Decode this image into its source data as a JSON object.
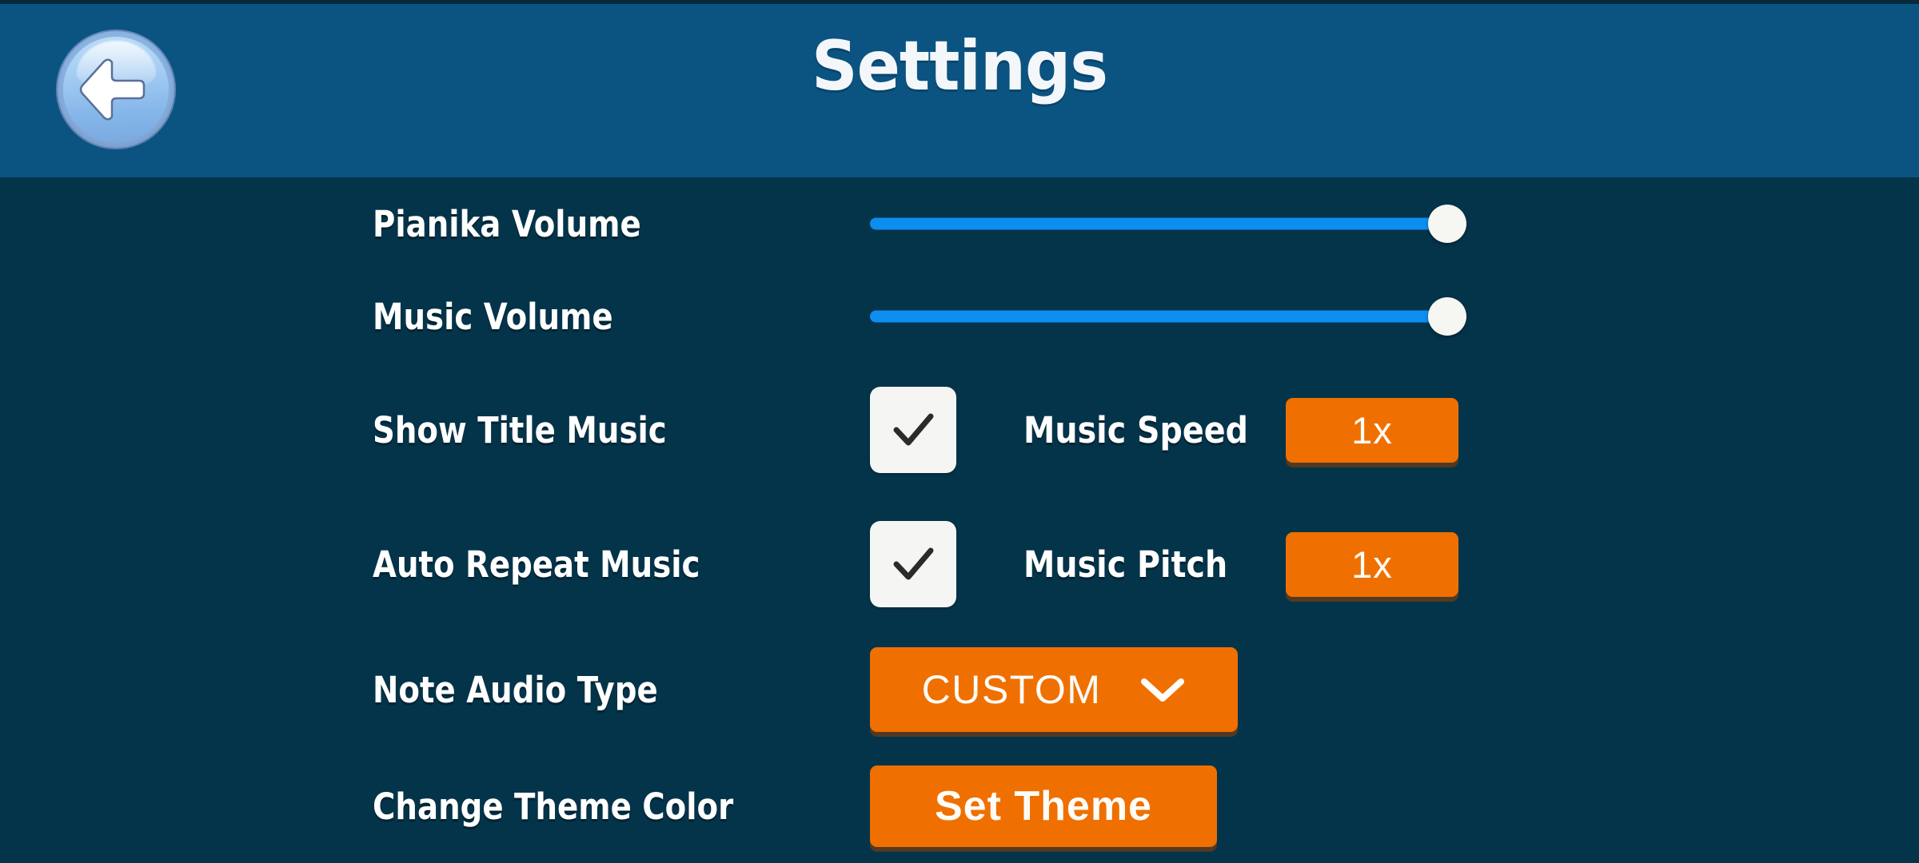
{
  "header": {
    "title": "Settings",
    "back_icon": "back-arrow-icon",
    "background_color": "#0b5482"
  },
  "theme": {
    "page_background": "#04344a",
    "accent_orange": "#ef7000",
    "slider_blue": "#0d8df0",
    "text_white": "#ffffff"
  },
  "rows": [
    {
      "id": "pianika-volume",
      "label": "Pianika Volume",
      "control": "slider",
      "value_percent": 100
    },
    {
      "id": "music-volume",
      "label": "Music Volume",
      "control": "slider",
      "value_percent": 100
    },
    {
      "id": "show-title-music",
      "label": "Show Title Music",
      "control": "checkbox",
      "checked": true,
      "secondary_label": "Music Speed",
      "secondary_value": "1x"
    },
    {
      "id": "auto-repeat-music",
      "label": "Auto Repeat Music",
      "control": "checkbox",
      "checked": true,
      "secondary_label": "Music Pitch",
      "secondary_value": "1x"
    },
    {
      "id": "note-audio-type",
      "label": "Note Audio Type",
      "control": "dropdown",
      "value": "CUSTOM",
      "dropdown_icon": "chevron-down-icon"
    },
    {
      "id": "change-theme-color",
      "label": "Change Theme Color",
      "control": "button",
      "value": "Set Theme"
    }
  ]
}
